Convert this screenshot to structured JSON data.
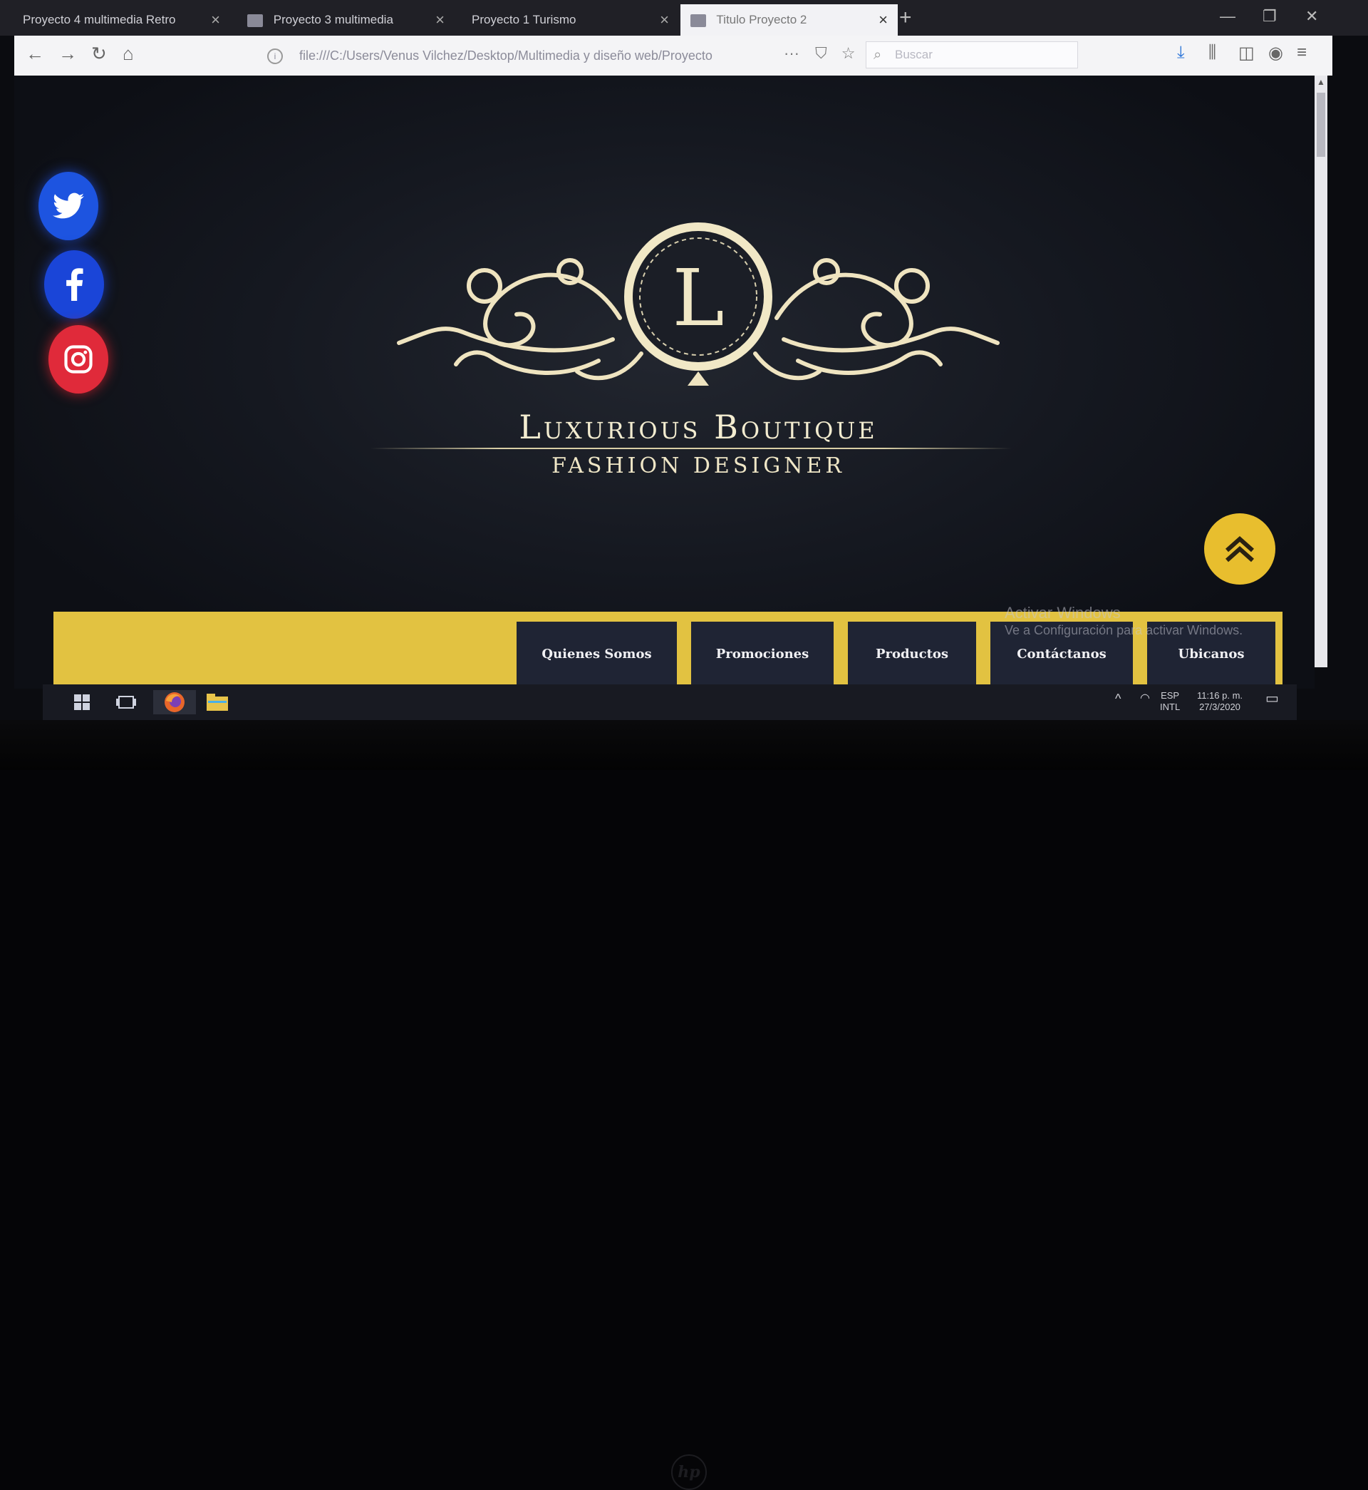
{
  "browser": {
    "tabs": [
      {
        "title": "Proyecto 4 multimedia Retro",
        "active": false
      },
      {
        "title": "Proyecto 3 multimedia",
        "active": false
      },
      {
        "title": "Proyecto 1 Turismo",
        "active": false
      },
      {
        "title": "Titulo Proyecto 2",
        "active": true
      }
    ],
    "url": "file:///C:/Users/Venus Vilchez/Desktop/Multimedia y diseño web/Proyecto",
    "search_placeholder": "Buscar"
  },
  "page": {
    "social_icons": [
      "twitter-icon",
      "facebook-icon",
      "instagram-icon"
    ],
    "emblem_letter": "L",
    "brand_title": "Luxurious Boutique",
    "brand_subtitle": "FASHION DESIGNER",
    "menu": [
      "Quienes Somos",
      "Promociones",
      "Productos",
      "Contáctanos",
      "Ubicanos"
    ],
    "colors": {
      "accent_yellow": "#e2c241",
      "menu_bg": "#1f2434",
      "background": "#151820",
      "gold_text": "#f3ecd0"
    }
  },
  "watermark": {
    "line1": "Activar Windows",
    "line2": "Ve a Configuración para activar Windows."
  },
  "taskbar": {
    "lang1": "ESP",
    "lang2": "INTL",
    "time": "11:16 p. m.",
    "date": "27/3/2020"
  }
}
